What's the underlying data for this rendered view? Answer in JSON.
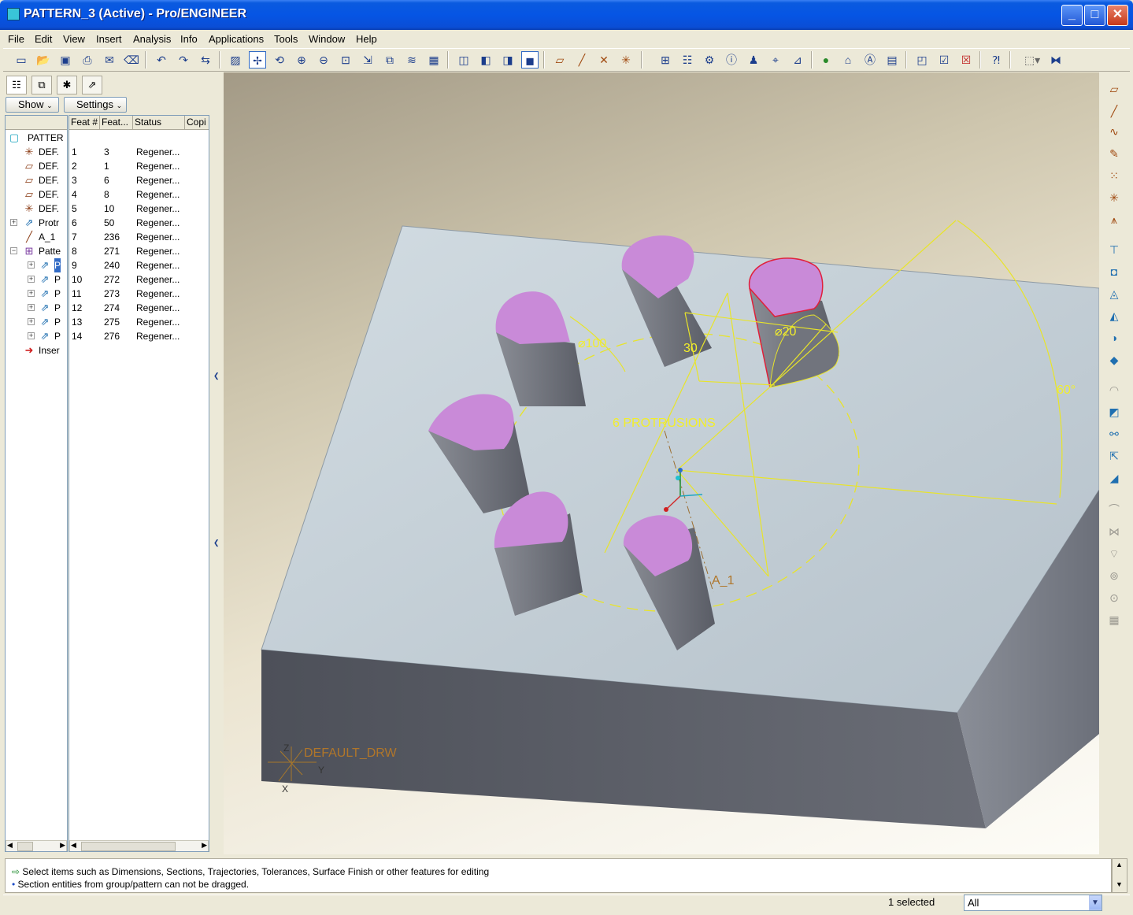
{
  "window": {
    "title": "PATTERN_3 (Active) - Pro/ENGINEER",
    "controls": {
      "minimize": "_",
      "maximize": "□",
      "close": "✕"
    }
  },
  "menu": [
    "File",
    "Edit",
    "View",
    "Insert",
    "Analysis",
    "Info",
    "Applications",
    "Tools",
    "Window",
    "Help"
  ],
  "toolbar_icons": [
    "new-icon",
    "open-icon",
    "save-icon",
    "print-icon",
    "send-icon",
    "erase-icon",
    "undo-icon",
    "redo-icon",
    "regenerate-icon",
    "repaint-icon",
    "spin-center-icon",
    "orient-icon",
    "zoom-in-icon",
    "zoom-out-icon",
    "refit-icon",
    "reorient-icon",
    "saved-views-icon",
    "layers-icon",
    "view-manager-icon",
    "wireframe-icon",
    "hidden-line-icon",
    "no-hidden-icon",
    "shading-icon",
    "datum-planes-icon",
    "datum-axes-icon",
    "datum-points-icon",
    "coord-sys-icon",
    "annotation-icon",
    "model-tree-icon",
    "setup-icon",
    "info-icon",
    "relations-icon",
    "parameters-icon",
    "measure-icon",
    "globe-icon",
    "camera-icon",
    "apps-icon",
    "window-icon",
    "activate-icon",
    "close-window-icon",
    "whats-this-icon",
    "filter-icon",
    "binoculars-icon"
  ],
  "navigator": {
    "tabs": [
      "model-tree-tab",
      "layers-tab",
      "favorites-tab",
      "connections-tab"
    ],
    "show_label": "Show",
    "settings_label": "Settings",
    "columns": [
      "Feat #",
      "Feat...",
      "Status",
      "Copi"
    ],
    "root": "PATTER",
    "rows": [
      {
        "name": "DEF.",
        "feat_num": "1",
        "feat_id": "3",
        "status": "Regener...",
        "icon": "datum-csys-icon"
      },
      {
        "name": "DEF.",
        "feat_num": "2",
        "feat_id": "1",
        "status": "Regener...",
        "icon": "datum-plane-icon"
      },
      {
        "name": "DEF.",
        "feat_num": "3",
        "feat_id": "6",
        "status": "Regener...",
        "icon": "datum-plane-icon"
      },
      {
        "name": "DEF.",
        "feat_num": "4",
        "feat_id": "8",
        "status": "Regener...",
        "icon": "datum-plane-icon"
      },
      {
        "name": "DEF.",
        "feat_num": "5",
        "feat_id": "10",
        "status": "Regener...",
        "icon": "datum-csys-icon"
      },
      {
        "name": "Protr",
        "feat_num": "6",
        "feat_id": "50",
        "status": "Regener...",
        "icon": "protrusion-icon"
      },
      {
        "name": "A_1",
        "feat_num": "7",
        "feat_id": "236",
        "status": "Regener...",
        "icon": "datum-axis-icon"
      },
      {
        "name": "Patte",
        "feat_num": "8",
        "feat_id": "271",
        "status": "Regener...",
        "icon": "pattern-icon"
      },
      {
        "name": "P",
        "feat_num": "9",
        "feat_id": "240",
        "status": "Regener...",
        "icon": "protrusion-icon"
      },
      {
        "name": "P",
        "feat_num": "10",
        "feat_id": "272",
        "status": "Regener...",
        "icon": "protrusion-icon"
      },
      {
        "name": "P",
        "feat_num": "11",
        "feat_id": "273",
        "status": "Regener...",
        "icon": "protrusion-icon"
      },
      {
        "name": "P",
        "feat_num": "12",
        "feat_id": "274",
        "status": "Regener...",
        "icon": "protrusion-icon"
      },
      {
        "name": "P",
        "feat_num": "13",
        "feat_id": "275",
        "status": "Regener...",
        "icon": "protrusion-icon"
      },
      {
        "name": "P",
        "feat_num": "14",
        "feat_id": "276",
        "status": "Regener...",
        "icon": "protrusion-icon"
      }
    ],
    "insert_label": "Inser"
  },
  "viewport": {
    "dim_diameter_100": "⌀100",
    "dim_30": "30",
    "dim_diameter_20": "⌀20",
    "dim_angle": "60°",
    "pattern_label": "6 PROTRUSIONS",
    "axis_label": "A_1",
    "csys_label": "DEFAULT_DRW",
    "csys_z": "Z",
    "csys_x": "X",
    "csys_y": "Y"
  },
  "right_toolbar_icons": [
    "datum-plane-icon",
    "datum-axis-icon",
    "datum-curve-icon",
    "sketch-icon",
    "datum-point-icon",
    "offset-point-icon",
    "field-point-icon",
    "extrude-icon",
    "revolve-icon",
    "sweep-icon",
    "blend-icon",
    "variable-sweep-icon",
    "hole-icon",
    "shell-icon",
    "rib-icon",
    "draft-icon",
    "round-icon",
    "chamfer-icon",
    "mirror-icon",
    "merge-icon",
    "trim-icon",
    "pattern-icon",
    "copy-icon",
    "group-icon"
  ],
  "messages": [
    "Select items such as Dimensions, Sections, Trajectories, Tolerances, Surface Finish or other features for editing",
    "Section entities from group/pattern can not be dragged."
  ],
  "status": {
    "selected": "1 selected",
    "filter_value": "All"
  },
  "colors": {
    "title_bar": "#0655e4",
    "block_top": "#bfccd6",
    "block_side": "#5c5f6a",
    "pin_top": "#c98ad8",
    "dimension": "#f2ee2a",
    "highlight": "#e0203a"
  }
}
